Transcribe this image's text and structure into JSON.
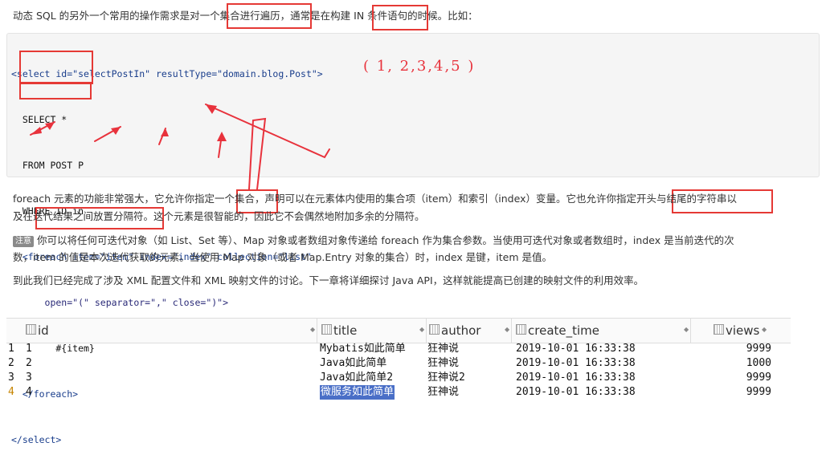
{
  "intro_text": "动态 SQL 的另外一个常用的操作需求是对一个集合进行遍历，通常是在构建 IN 条件语句的时候。比如：",
  "code_lines": [
    "<select id=\"selectPostIn\" resultType=\"domain.blog.Post\">",
    "  SELECT *",
    "  FROM POST P",
    "  WHERE ID in",
    "  <foreach item=\"item\" index=\"index\" collection=\"list\"",
    "      open=\"(\" separator=\",\" close=\")\">",
    "        #{item}",
    "  </foreach>",
    "</select>"
  ],
  "annotation": "( 1, 2,3,4,5 )",
  "para1_line1": "foreach 元素的功能非常强大，它允许你指定一个集合，声明可以在元素体内使用的集合项（item）和索引（index）变量。它也允许你指定开头与结尾的字符串以",
  "para1_line2": "及在迭代结果之间放置分隔符。这个元素是很智能的，因此它不会偶然地附加多余的分隔符。",
  "note_badge": "注意",
  "para2_line1": "你可以将任何可迭代对象（如 List、Set 等）、Map 对象或者数组对象传递给 foreach 作为集合参数。当使用可迭代对象或者数组时，index 是当前迭代的次",
  "para2_line2": "数，item 的值是本次迭代获取的元素。当使用 Map 对象（或者 Map.Entry 对象的集合）时，index 是键，item 是值。",
  "para3": "到此我们已经完成了涉及 XML 配置文件和 XML 映射文件的讨论。下一章将详细探讨 Java API，这样就能提高已创建的映射文件的利用效率。",
  "table": {
    "columns": [
      "id",
      "title",
      "author",
      "create_time",
      "views"
    ],
    "rows": [
      {
        "n": "1",
        "id": "1",
        "title": "Mybatis如此简单",
        "author": "狂神说",
        "create_time": "2019-10-01 16:33:38",
        "views": "9999"
      },
      {
        "n": "2",
        "id": "2",
        "title": "Java如此简单",
        "author": "狂神说",
        "create_time": "2019-10-01 16:33:38",
        "views": "1000"
      },
      {
        "n": "3",
        "id": "3",
        "title": "Java如此简单2",
        "author": "狂神说2",
        "create_time": "2019-10-01 16:33:38",
        "views": "9999"
      },
      {
        "n": "4",
        "id": "4",
        "title": "微服务如此简单",
        "author": "狂神说",
        "create_time": "2019-10-01 16:33:38",
        "views": "9999"
      }
    ]
  }
}
